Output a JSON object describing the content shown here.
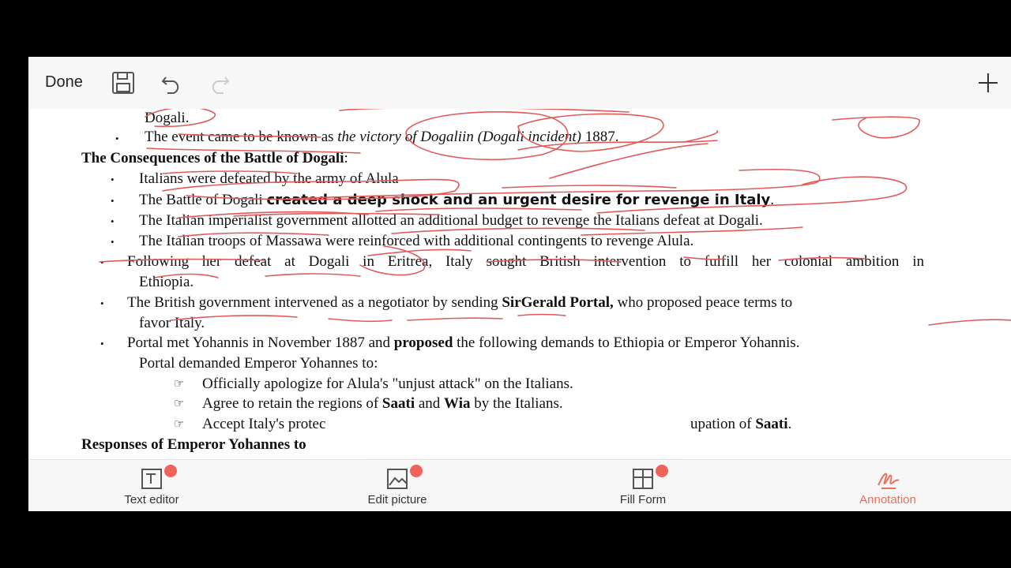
{
  "toolbar": {
    "done_label": "Done"
  },
  "document": {
    "lines": {
      "l0": "Dogali.",
      "l1a": "The event came to be known as ",
      "l1b": "the victory of Dogaliin (Dogali incident)",
      "l1c": " 1887.",
      "h1": "The Consequences of the Battle of Dogali",
      "h1colon": ":",
      "b1": "Italians were defeated by the army of Alula",
      "b2a": "The Battle of Dogali ",
      "b2b": "created a deep shock and an urgent desire for revenge in Italy",
      "b2c": ".",
      "b3": "The Italian imperialist government allotted an additional budget to revenge the Italians defeat at Dogali.",
      "b4": "The Italian troops of Massawa were reinforced with additional contingents to revenge Alula.",
      "b5a": "Following her defeat at Dogali in Eritrea, Italy sought British intervention to fulfill her colonial ambition in",
      "b5b": "Ethiopia.",
      "b6a": "The British government intervened as a negotiator by sending ",
      "b6b": "SirGerald Portal,",
      "b6c": " who proposed peace terms to",
      "b6d": "favor Italy.",
      "b7a": "Portal met Yohannis in November 1887 and ",
      "b7b": "proposed",
      "b7c": " the following demands to Ethiopia or Emperor Yohannis.",
      "b7d": "Portal demanded Emperor Yohannes to:",
      "s1": "Officially apologize for Alula's \"unjust attack\" on the Italians.",
      "s2a": "Agree to retain the regions of ",
      "s2b": "Saati",
      "s2c": " and ",
      "s2d": "Wia",
      "s2e": " by the Italians.",
      "s3a": "Accept Italy's protec",
      "s3b": "upation of ",
      "s3c": "Saati",
      "s3d": ".",
      "h2": "Responses of Emperor Yohannes to"
    },
    "bullet_char": "•",
    "hand_char": "☞"
  },
  "bottom_bar": {
    "items": [
      {
        "label": "Text editor",
        "icon": "text-editor-icon"
      },
      {
        "label": "Edit picture",
        "icon": "edit-picture-icon"
      },
      {
        "label": "Fill Form",
        "icon": "fill-form-icon"
      },
      {
        "label": "Annotation",
        "icon": "annotation-icon"
      }
    ]
  },
  "colors": {
    "accent": "#e8705a",
    "ink": "#e05a5a",
    "highlighter": "#f5e400",
    "badge": "#f0635a"
  }
}
